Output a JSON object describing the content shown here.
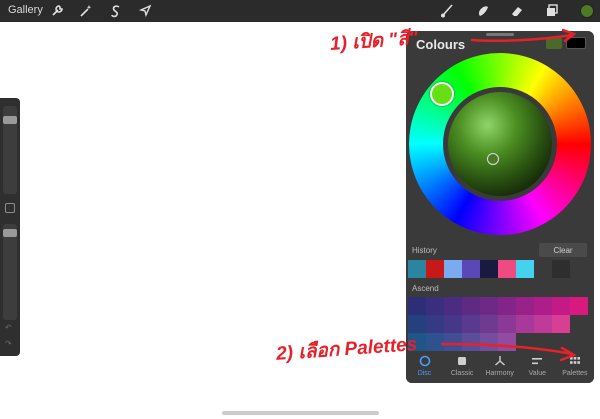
{
  "topbar": {
    "gallery_label": "Gallery",
    "left_tools": [
      "wrench-icon",
      "magic-wand-icon",
      "selection-s-icon",
      "transform-arrow-icon"
    ],
    "right_tools": [
      "brush-icon",
      "smudge-icon",
      "eraser-icon",
      "layers-icon"
    ],
    "current_color": "#4e7a24"
  },
  "panel": {
    "title": "Colours",
    "primary_color": "#4a6a2a",
    "secondary_color": "#000000",
    "history_label": "History",
    "clear_label": "Clear",
    "history": [
      "#2a86a0",
      "#c81818",
      "#7aaaf0",
      "#5a48b8",
      "#1a1a40",
      "#f04a82",
      "#44d2ee",
      "#3a3a3a",
      "#2e2e2e"
    ],
    "palette_label": "Ascend",
    "palette_rows": [
      [
        "#2d2e78",
        "#3a2f7e",
        "#4b2c80",
        "#5e2a84",
        "#6e2886",
        "#832488",
        "#98218a",
        "#ae1e8a",
        "#c41a88",
        "#d81a7e"
      ],
      [
        "#25407e",
        "#353a84",
        "#463888",
        "#5a3a8e",
        "#6e3a92",
        "#8a3a96",
        "#a8389a",
        "#c03a9a",
        "#d83e92"
      ],
      [
        "#1e568a",
        "#2e528e",
        "#424e92",
        "#5a4e98",
        "#744e9c",
        "#904ca0"
      ]
    ],
    "tabs": [
      {
        "label": "Disc",
        "icon": "disc-icon",
        "active": true
      },
      {
        "label": "Classic",
        "icon": "classic-square-icon",
        "active": false
      },
      {
        "label": "Harmony",
        "icon": "harmony-icon",
        "active": false
      },
      {
        "label": "Value",
        "icon": "value-sliders-icon",
        "active": false
      },
      {
        "label": "Palettes",
        "icon": "palettes-grid-icon",
        "active": false
      }
    ]
  },
  "annotations": {
    "step1": "1) เปิด \"สี\"",
    "step2": "2) เลือก Palettes",
    "color": "#e8202a"
  }
}
